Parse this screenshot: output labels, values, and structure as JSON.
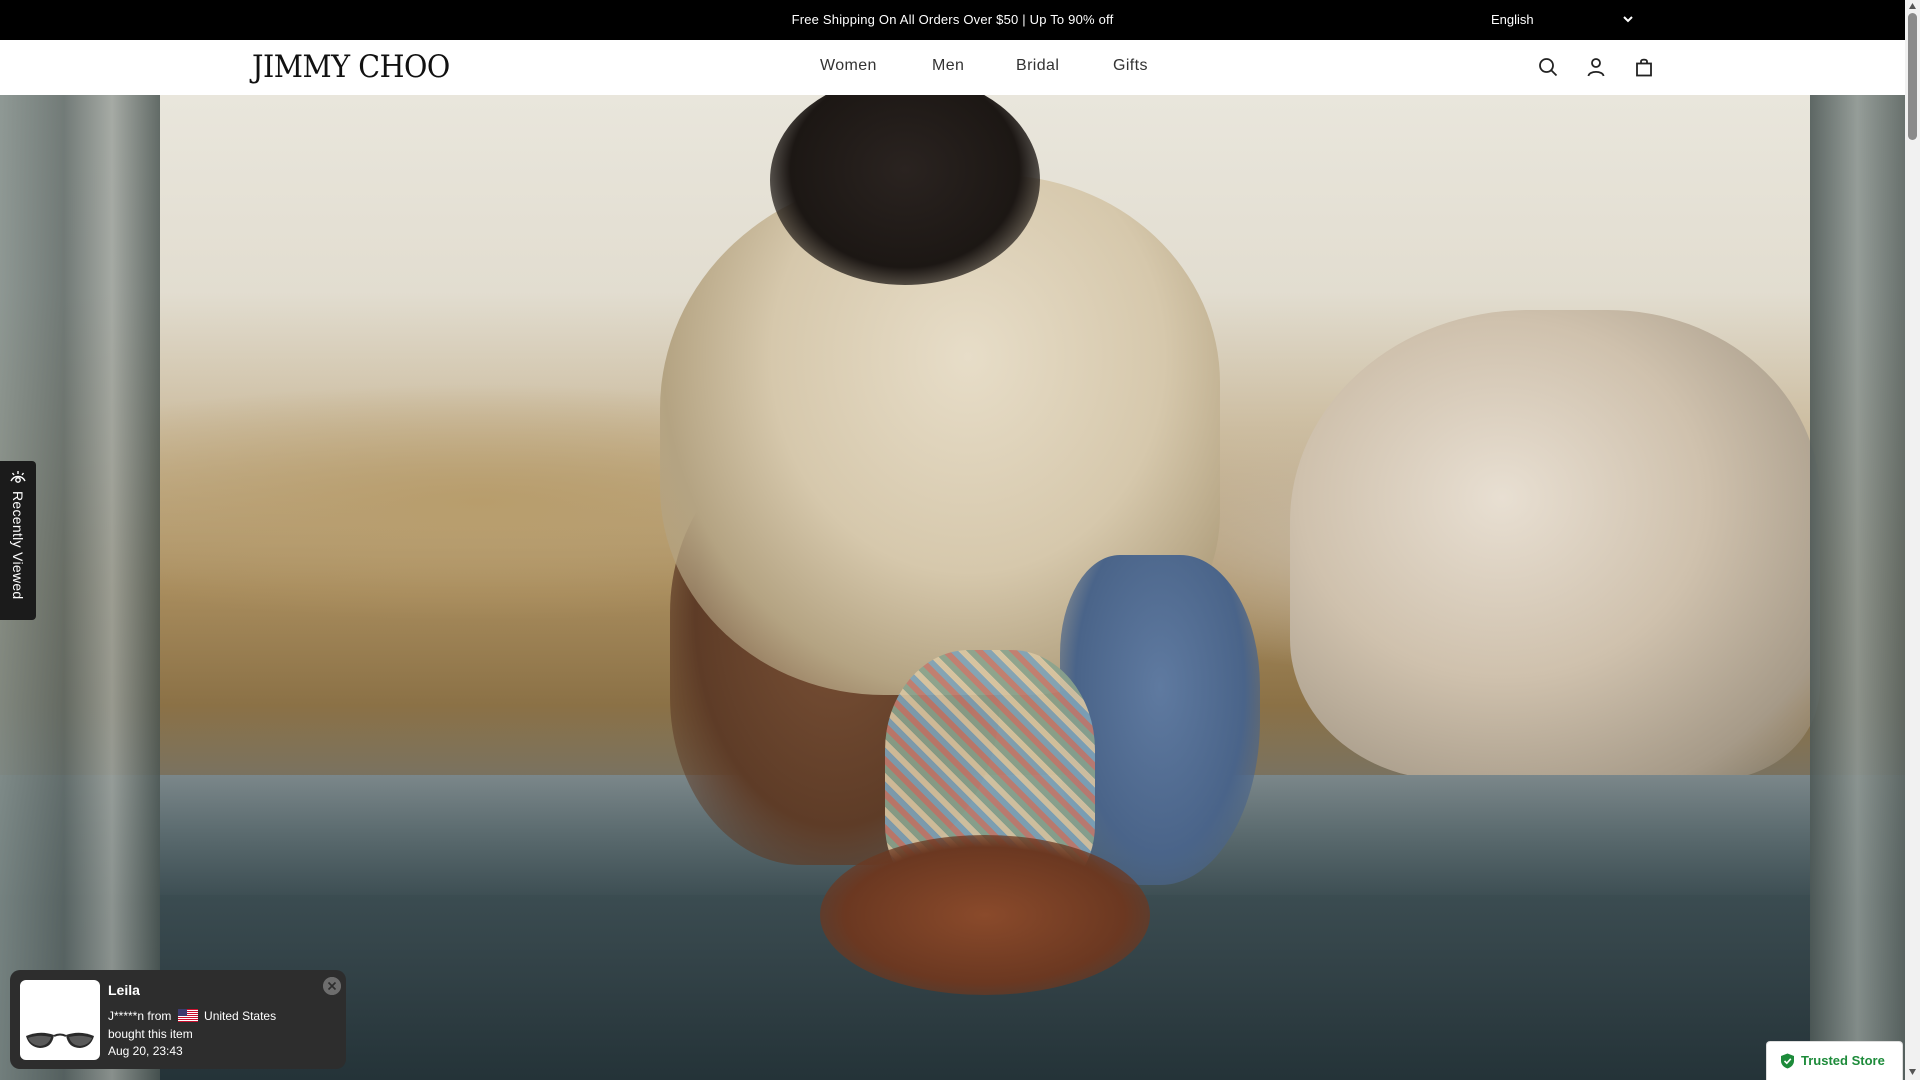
{
  "announcement": {
    "text": "Free Shipping On All Orders Over $50 | Up To 90% off",
    "language": "English"
  },
  "header": {
    "logo": "JIMMY CHOO",
    "nav": [
      "Women",
      "Men",
      "Bridal",
      "Gifts"
    ],
    "icons": [
      "search-icon",
      "account-icon",
      "bag-icon"
    ]
  },
  "hero": {
    "image_subject": "model crouching holding woven drawstring bag in front of desert window"
  },
  "recently_viewed": {
    "label": "Recently Viewed"
  },
  "purchase_popup": {
    "name": "Leila",
    "buyer": "J*****n from",
    "country": "United States",
    "action": "bought this item",
    "time": "Aug 20, 23:43"
  },
  "trusted_store": {
    "label": "Trusted Store"
  },
  "colors": {
    "announcement_bg": "#000000",
    "popup_bg": "#2d2d2d",
    "trusted_green": "#1d8b3a"
  }
}
